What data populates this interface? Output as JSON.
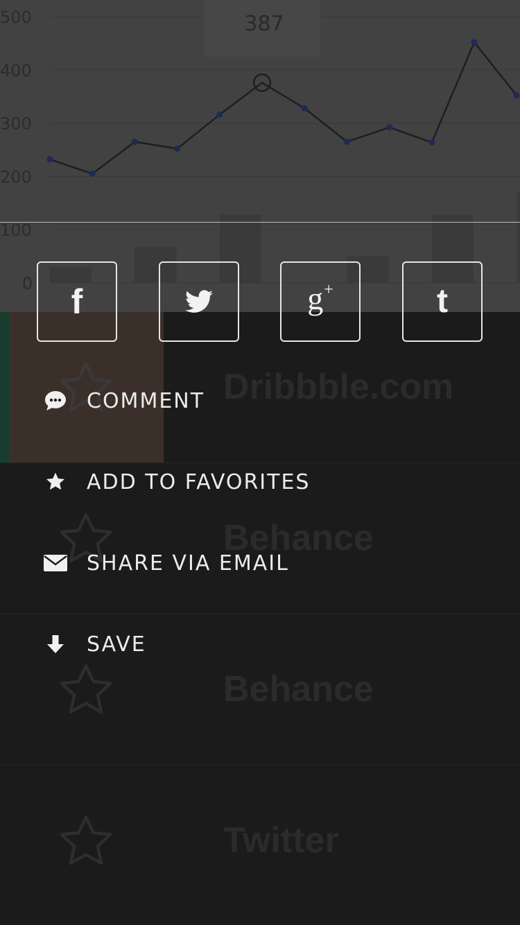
{
  "chart_data": {
    "type": "line",
    "y_ticks": [
      "500",
      "400",
      "300",
      "200",
      "100",
      "0"
    ],
    "ylim": [
      0,
      500
    ],
    "series": [
      {
        "values": [
          232,
          205,
          265,
          252,
          316,
          376,
          328,
          265,
          292,
          264,
          452,
          352
        ]
      }
    ],
    "bars": [
      30,
      0,
      68,
      0,
      128,
      0,
      0,
      50,
      0,
      128,
      0,
      170
    ],
    "highlight": {
      "index": 5,
      "label": "387"
    },
    "colors": {
      "line": "#1e1e1e",
      "point": "#1f2a55",
      "bar": "#3a3a3a",
      "grid": "#3a3a3a"
    }
  },
  "background_list": {
    "items": [
      {
        "title": "Dribbble.com",
        "accent": "#173d2e",
        "thumb": "#3b3029"
      },
      {
        "title": "Behance",
        "accent": "",
        "thumb": ""
      },
      {
        "title": "Behance",
        "accent": "",
        "thumb": ""
      },
      {
        "title": "Twitter",
        "accent": "",
        "thumb": ""
      }
    ]
  },
  "share": {
    "social": [
      {
        "name": "facebook",
        "glyph": "f",
        "icon": "facebook-icon"
      },
      {
        "name": "twitter",
        "glyph": "",
        "icon": "twitter-bird-icon"
      },
      {
        "name": "google-plus",
        "glyph": "g",
        "glyph_sup": "+",
        "icon": "google-plus-icon"
      },
      {
        "name": "tumblr",
        "glyph": "t",
        "icon": "tumblr-icon"
      }
    ],
    "actions": [
      {
        "label": "COMMENT",
        "icon": "speech-bubble-icon"
      },
      {
        "label": "ADD TO FAVORITES",
        "icon": "star-icon"
      },
      {
        "label": "SHARE VIA EMAIL",
        "icon": "envelope-icon"
      },
      {
        "label": "SAVE",
        "icon": "download-arrow-icon"
      }
    ]
  }
}
